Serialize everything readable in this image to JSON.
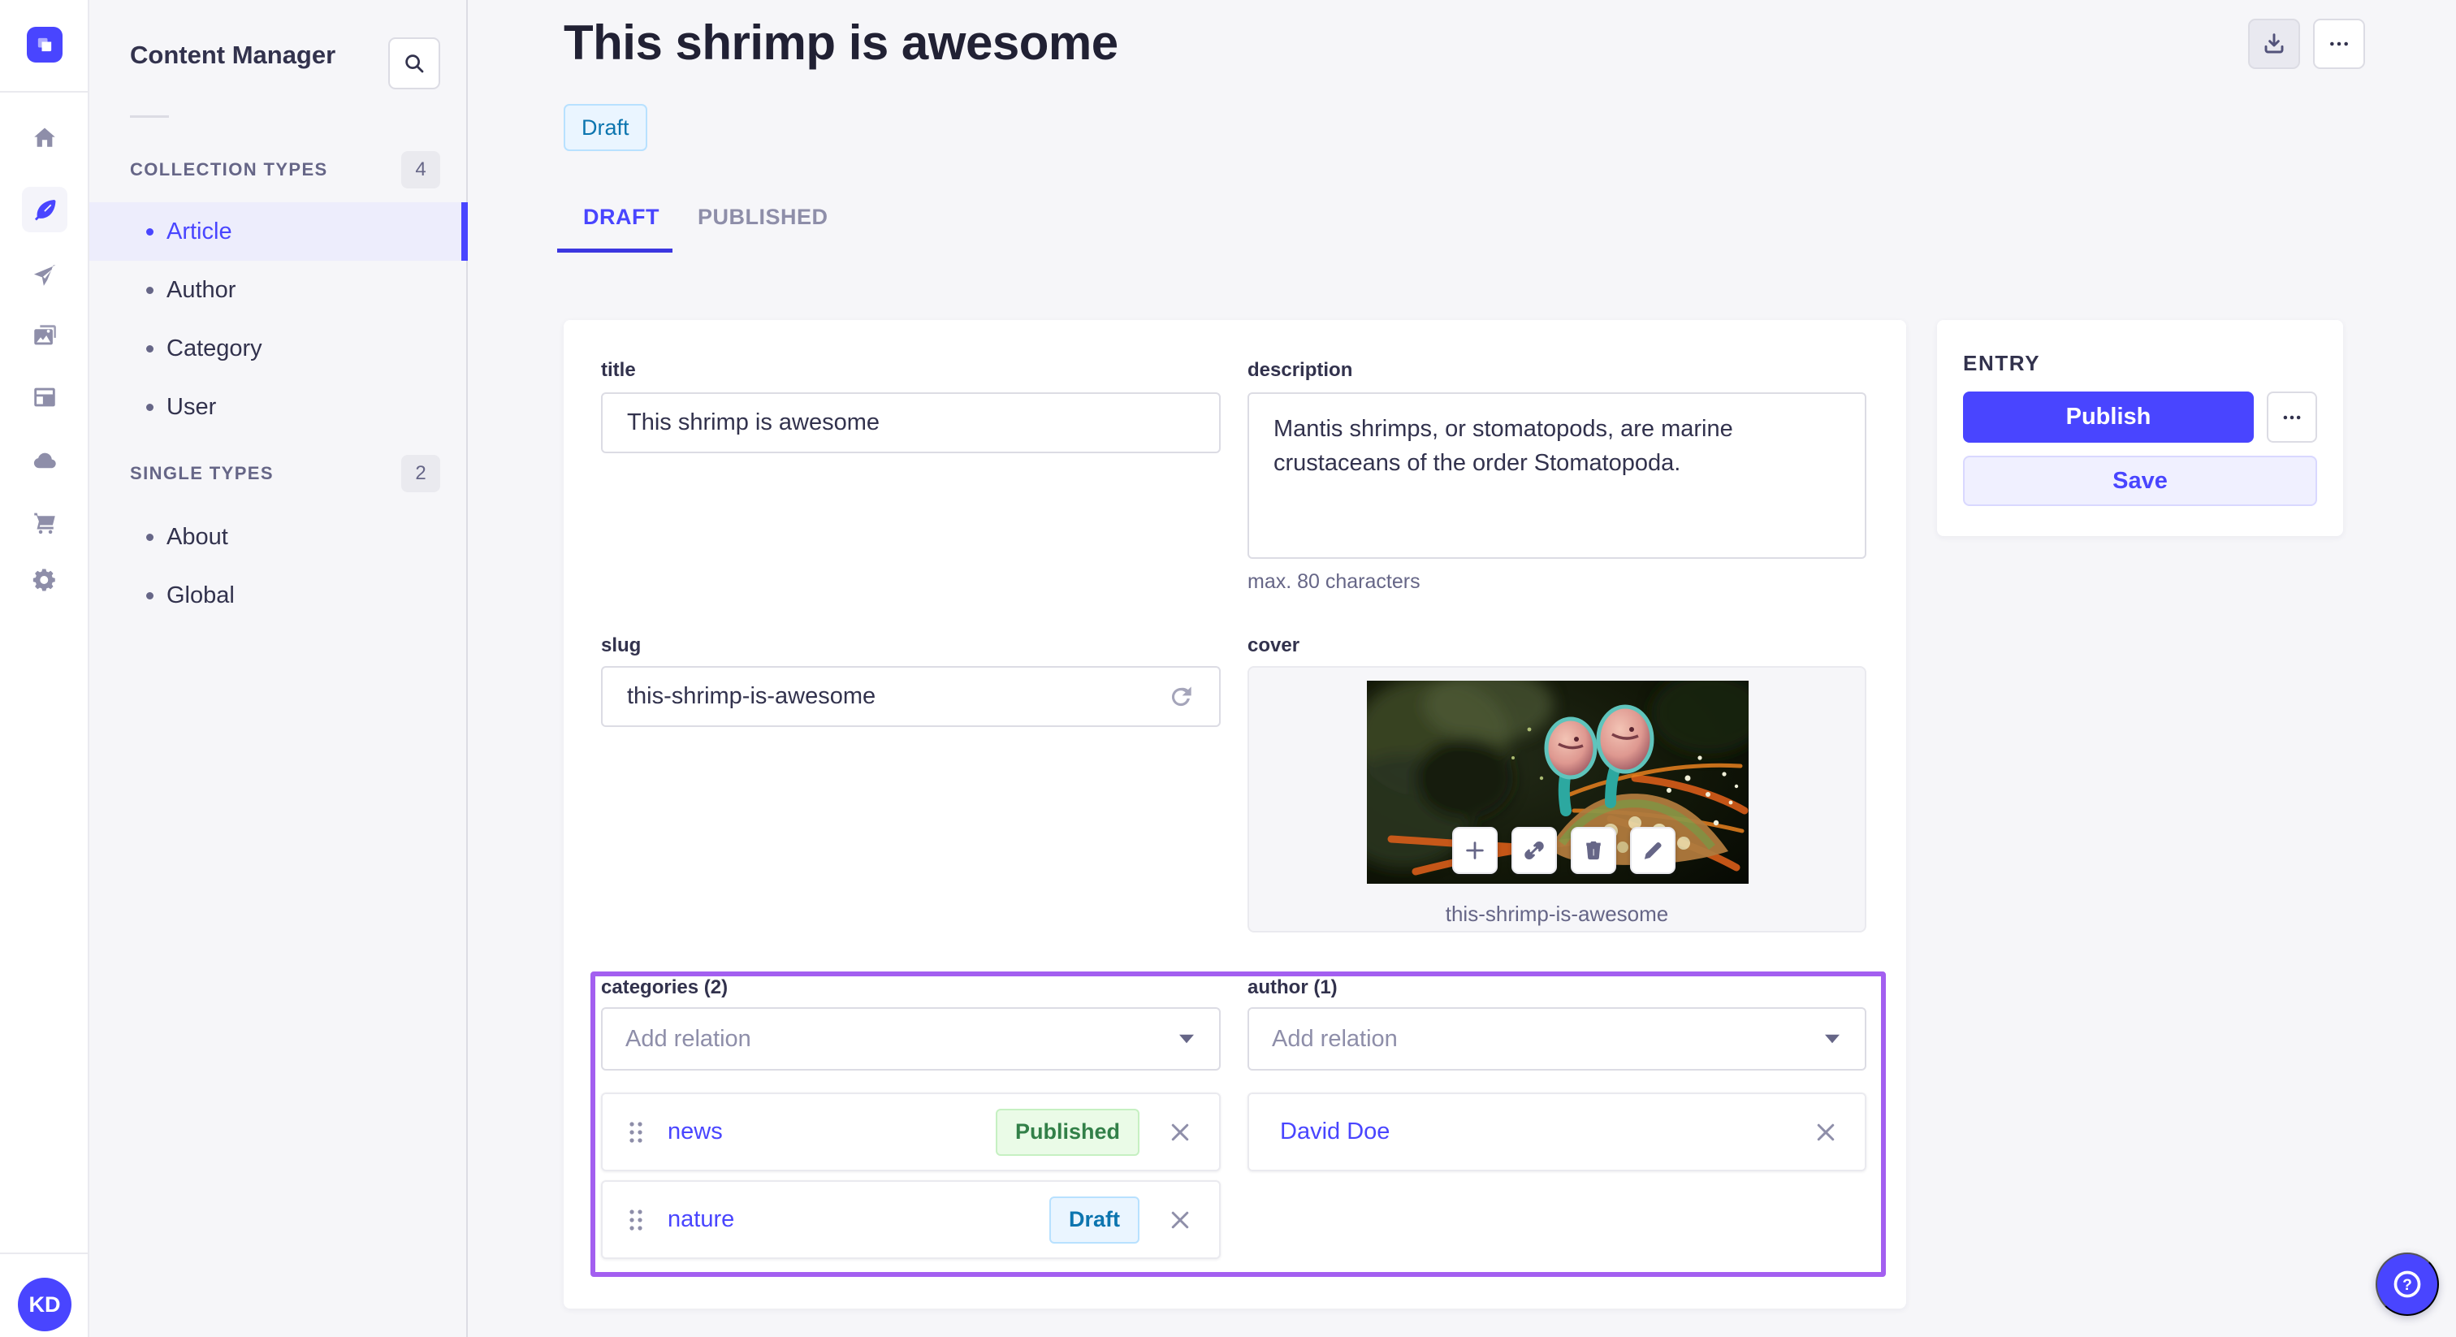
{
  "colors": {
    "primary": "#4945FF",
    "primary_light_bg": "#F0F0FF",
    "highlight_border": "#A35FF0",
    "published_text": "#328048",
    "published_bg": "#EAFBE7",
    "draft_text": "#0C75AF",
    "draft_bg": "#EAF5FF",
    "neutral_bg": "#F6F6F9"
  },
  "rail": {
    "avatar_initials": "KD"
  },
  "subnav": {
    "title": "Content Manager",
    "sections": [
      {
        "label": "COLLECTION TYPES",
        "count": "4",
        "items": [
          {
            "label": "Article"
          },
          {
            "label": "Author"
          },
          {
            "label": "Category"
          },
          {
            "label": "User"
          }
        ]
      },
      {
        "label": "SINGLE TYPES",
        "count": "2",
        "items": [
          {
            "label": "About"
          },
          {
            "label": "Global"
          }
        ]
      }
    ]
  },
  "header": {
    "title": "This shrimp is awesome",
    "status": "Draft",
    "tabs": [
      {
        "label": "DRAFT"
      },
      {
        "label": "PUBLISHED"
      }
    ]
  },
  "form": {
    "title": {
      "label": "title",
      "value": "This shrimp is awesome"
    },
    "description": {
      "label": "description",
      "value": "Mantis shrimps, or stomatopods, are marine crustaceans of the order Stomatopoda.",
      "hint": "max. 80 characters"
    },
    "slug": {
      "label": "slug",
      "value": "this-shrimp-is-awesome"
    },
    "cover": {
      "label": "cover",
      "caption": "this-shrimp-is-awesome"
    },
    "categories": {
      "label": "categories (2)",
      "placeholder": "Add relation",
      "items": [
        {
          "name": "news",
          "status": "Published"
        },
        {
          "name": "nature",
          "status": "Draft"
        }
      ]
    },
    "author": {
      "label": "author (1)",
      "placeholder": "Add relation",
      "items": [
        {
          "name": "David Doe"
        }
      ]
    }
  },
  "entry": {
    "title": "ENTRY",
    "publish": "Publish",
    "save": "Save"
  }
}
